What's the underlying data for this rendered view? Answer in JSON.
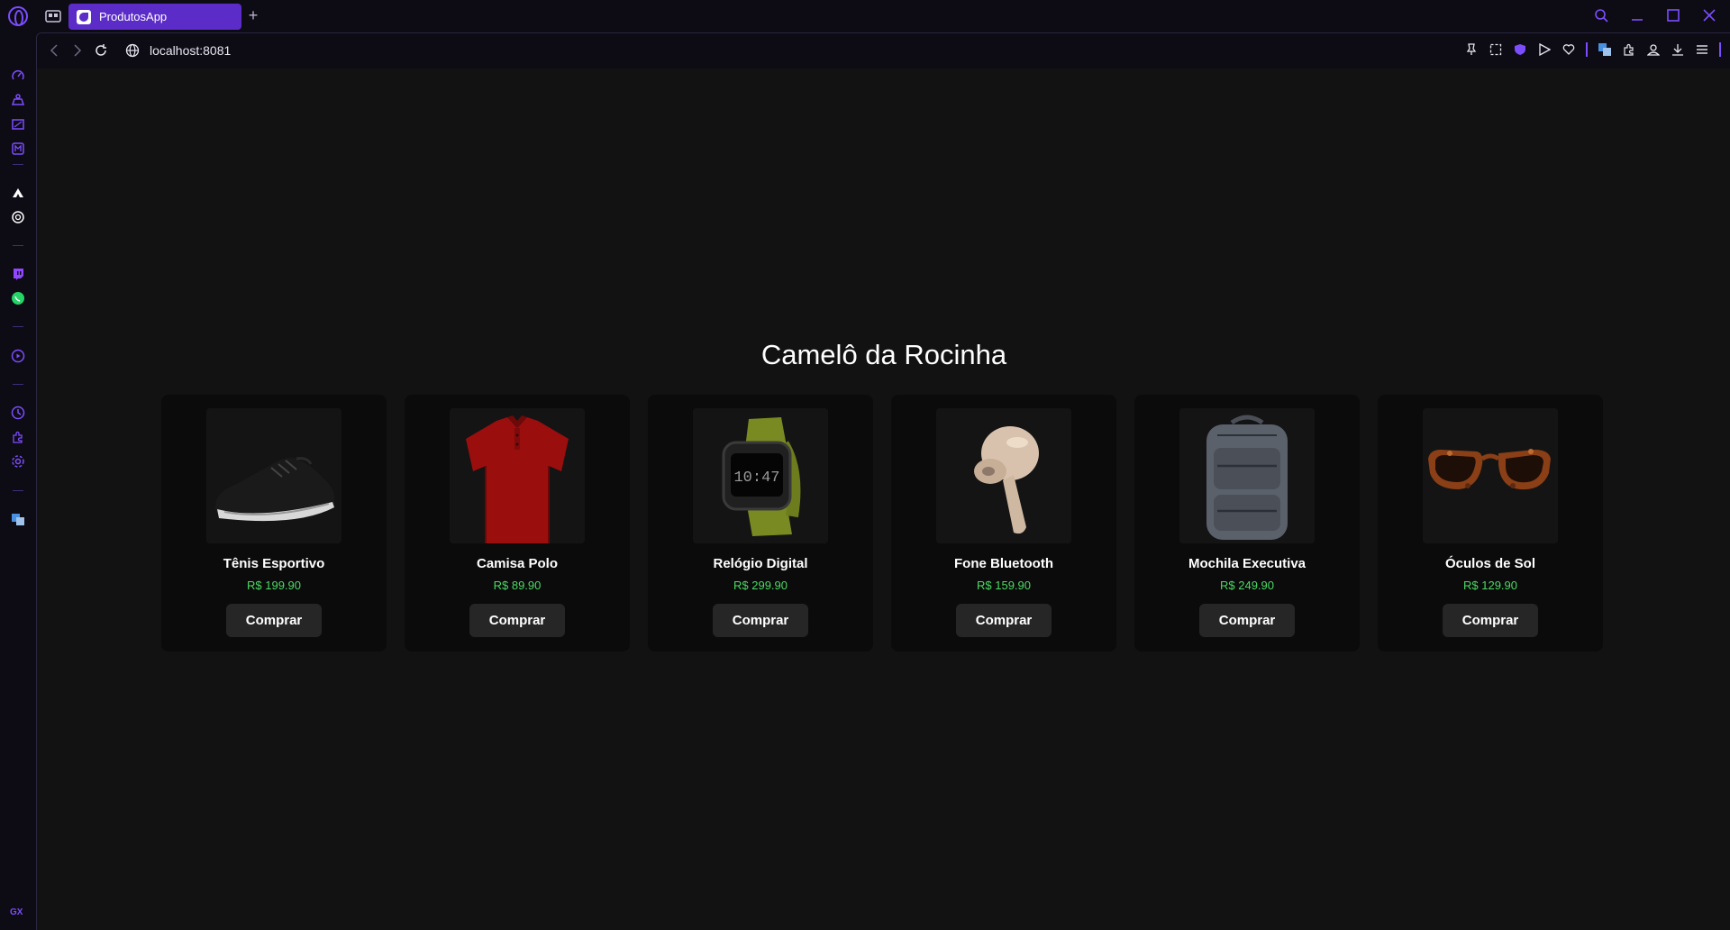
{
  "browser": {
    "tab_title": "ProdutosApp",
    "new_tab_label": "+",
    "url": "localhost:8081",
    "sidebar_gx_label": "GX",
    "sidebar_more_label": "···",
    "accent_color": "#7c4dff"
  },
  "page": {
    "title": "Camelô da Rocinha",
    "products": [
      {
        "name": "Tênis Esportivo",
        "price": "R$ 199.90",
        "button": "Comprar",
        "image_icon": "sneaker-image"
      },
      {
        "name": "Camisa Polo",
        "price": "R$ 89.90",
        "button": "Comprar",
        "image_icon": "polo-shirt-image"
      },
      {
        "name": "Relógio Digital",
        "price": "R$ 299.90",
        "button": "Comprar",
        "image_icon": "digital-watch-image",
        "watch_time": "10:47"
      },
      {
        "name": "Fone Bluetooth",
        "price": "R$ 159.90",
        "button": "Comprar",
        "image_icon": "earbud-image"
      },
      {
        "name": "Mochila Executiva",
        "price": "R$ 249.90",
        "button": "Comprar",
        "image_icon": "backpack-image"
      },
      {
        "name": "Óculos de Sol",
        "price": "R$ 129.90",
        "button": "Comprar",
        "image_icon": "sunglasses-image"
      }
    ],
    "price_color": "#4cd964"
  }
}
